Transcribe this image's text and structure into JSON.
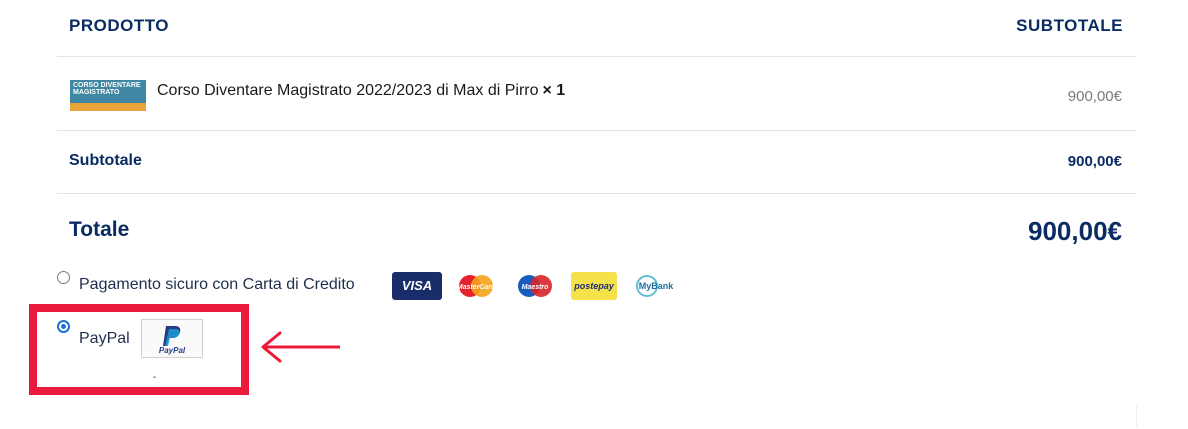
{
  "table": {
    "header_product": "PRODOTTO",
    "header_subtotal": "SUBTOTALE",
    "item": {
      "name": "Corso Diventare Magistrato 2022/2023 di Max di Pirro",
      "qty": "× 1",
      "price": "900,00€",
      "thumb_title": "CORSO DIVENTARE MAGISTRATO"
    },
    "subtotal_label": "Subtotale",
    "subtotal_value": "900,00€",
    "total_label": "Totale",
    "total_value": "900,00€"
  },
  "payment": {
    "card_option": {
      "label": "Pagamento sicuro con Carta di Credito",
      "selected": false
    },
    "cards": {
      "visa": "VISA",
      "mastercard": "MasterCard",
      "maestro": "Maestro",
      "postepay": "postepay",
      "mybank": "MyBank"
    },
    "paypal_option": {
      "label": "PayPal",
      "selected": true,
      "logo_text": "PayPal"
    },
    "paypal_sub": "-"
  },
  "colors": {
    "navy": "#0b2c63",
    "highlight": "#ec1a3a",
    "radio": "#1f6fd6"
  }
}
